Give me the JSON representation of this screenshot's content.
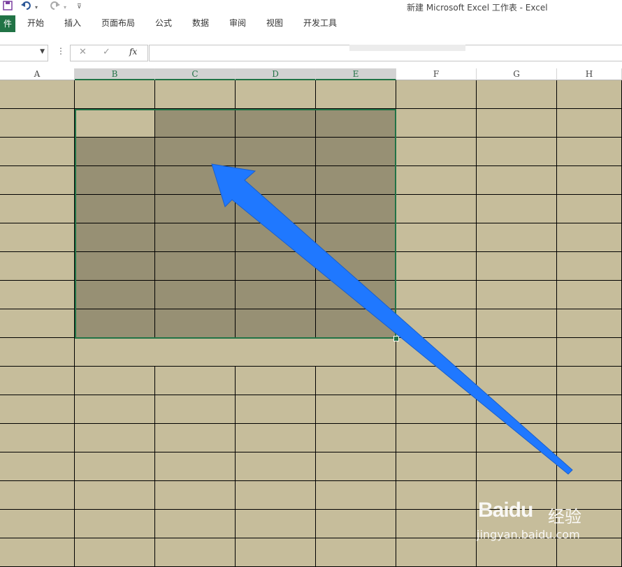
{
  "window": {
    "title": "新建 Microsoft Excel 工作表 - Excel"
  },
  "quick_access": {
    "save_icon": "save-icon",
    "undo_icon": "undo-icon",
    "redo_icon": "redo-icon",
    "customize_icon": "customize-icon"
  },
  "ribbon": {
    "file_tab": "件",
    "tabs": [
      "开始",
      "插入",
      "页面布局",
      "公式",
      "数据",
      "审阅",
      "视图",
      "开发工具"
    ]
  },
  "formula_bar": {
    "name_box_value": "",
    "cancel_symbol": "✕",
    "enter_symbol": "✓",
    "function_symbol": "fx",
    "formula_value": ""
  },
  "sheet": {
    "columns": [
      "A",
      "B",
      "C",
      "D",
      "E",
      "F",
      "G",
      "H"
    ],
    "selected_columns": [
      "B",
      "C",
      "D",
      "E"
    ],
    "selection": "B2:E9",
    "colors": {
      "cell_bg": "#c6bd9b",
      "selected_bg": "#979074",
      "selection_border": "#217346",
      "arrow": "#1f78ff"
    }
  },
  "watermark": {
    "brand": "Baidu",
    "chinese": "经验",
    "url": "jingyan.baidu.com"
  }
}
